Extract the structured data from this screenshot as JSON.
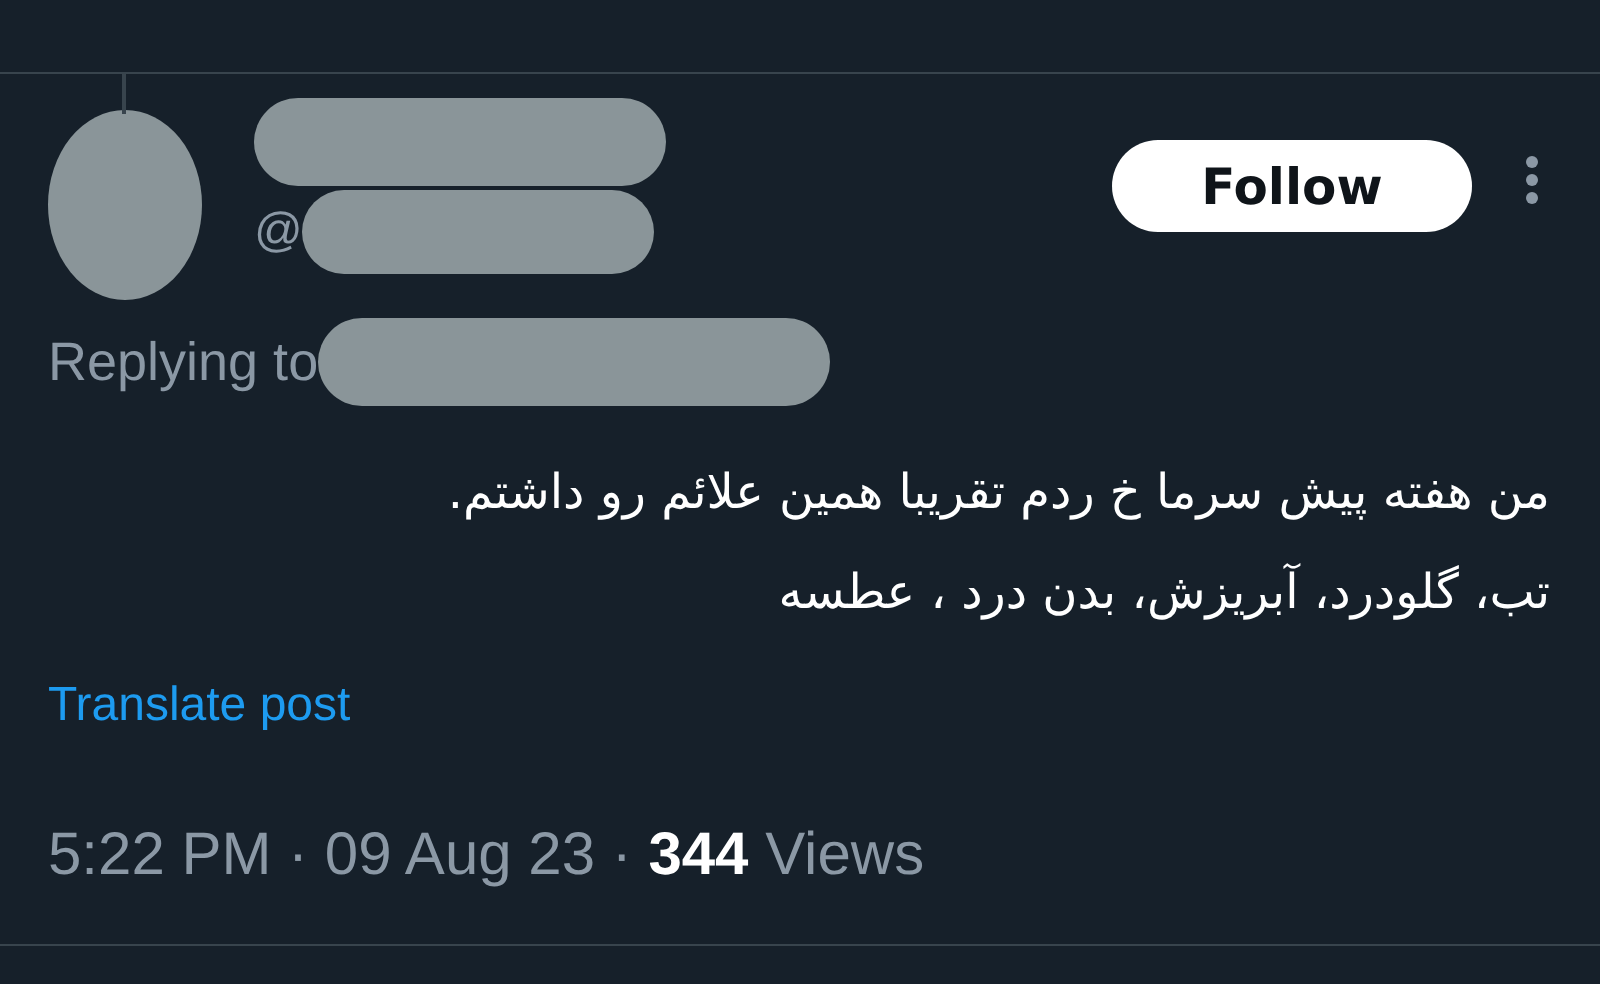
{
  "post": {
    "follow_button": "Follow",
    "handle_prefix": "@",
    "replying_label": "Replying to",
    "text_lines": [
      "من هفته پیش سرما خ ردم تقریبا همین علائم رو داشتم.",
      "تب، گلودرد، آبریزش، بدن درد ، عطسه"
    ],
    "translate_link": "Translate post",
    "meta": {
      "separator": "·",
      "time": "5:22 PM",
      "date": "09 Aug 23",
      "views_count": "344",
      "views_label": "Views"
    }
  }
}
